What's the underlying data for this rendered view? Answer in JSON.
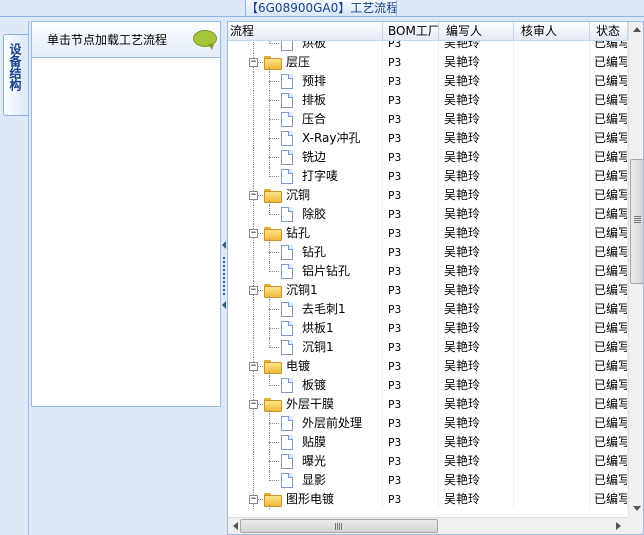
{
  "window": {
    "title": "【6G08900GA0】工艺流程"
  },
  "side_tab": {
    "label": "设备结构"
  },
  "left_panel": {
    "hint": "单击节点加载工艺流程",
    "hint_icon": "speech-bubble-icon"
  },
  "grid": {
    "columns": [
      "流程",
      "BOM工厂",
      "编写人",
      "核审人",
      "状态"
    ],
    "rows": [
      {
        "label": "烘板",
        "type": "leaf",
        "bom": "P3",
        "author": "吴艳玲",
        "reviewer": "",
        "status": "已编写"
      },
      {
        "label": "层压",
        "type": "folder",
        "bom": "P3",
        "author": "吴艳玲",
        "reviewer": "",
        "status": "已编写"
      },
      {
        "label": "预排",
        "type": "leaf",
        "bom": "P3",
        "author": "吴艳玲",
        "reviewer": "",
        "status": "已编写"
      },
      {
        "label": "排板",
        "type": "leaf",
        "bom": "P3",
        "author": "吴艳玲",
        "reviewer": "",
        "status": "已编写"
      },
      {
        "label": "压合",
        "type": "leaf",
        "bom": "P3",
        "author": "吴艳玲",
        "reviewer": "",
        "status": "已编写"
      },
      {
        "label": "X-Ray冲孔",
        "type": "leaf",
        "bom": "P3",
        "author": "吴艳玲",
        "reviewer": "",
        "status": "已编写"
      },
      {
        "label": "铣边",
        "type": "leaf",
        "bom": "P3",
        "author": "吴艳玲",
        "reviewer": "",
        "status": "已编写"
      },
      {
        "label": "打字唛",
        "type": "leaf",
        "bom": "P3",
        "author": "吴艳玲",
        "reviewer": "",
        "status": "已编写"
      },
      {
        "label": "沉铜",
        "type": "folder",
        "bom": "P3",
        "author": "吴艳玲",
        "reviewer": "",
        "status": "已编写"
      },
      {
        "label": "除胶",
        "type": "leaf",
        "bom": "P3",
        "author": "吴艳玲",
        "reviewer": "",
        "status": "已编写"
      },
      {
        "label": "钻孔",
        "type": "folder",
        "bom": "P3",
        "author": "吴艳玲",
        "reviewer": "",
        "status": "已编写"
      },
      {
        "label": "钻孔",
        "type": "leaf",
        "bom": "P3",
        "author": "吴艳玲",
        "reviewer": "",
        "status": "已编写"
      },
      {
        "label": "铝片钻孔",
        "type": "leaf",
        "bom": "P3",
        "author": "吴艳玲",
        "reviewer": "",
        "status": "已编写"
      },
      {
        "label": "沉铜1",
        "type": "folder",
        "bom": "P3",
        "author": "吴艳玲",
        "reviewer": "",
        "status": "已编写"
      },
      {
        "label": "去毛刺1",
        "type": "leaf",
        "bom": "P3",
        "author": "吴艳玲",
        "reviewer": "",
        "status": "已编写"
      },
      {
        "label": "烘板1",
        "type": "leaf",
        "bom": "P3",
        "author": "吴艳玲",
        "reviewer": "",
        "status": "已编写"
      },
      {
        "label": "沉铜1",
        "type": "leaf",
        "bom": "P3",
        "author": "吴艳玲",
        "reviewer": "",
        "status": "已编写"
      },
      {
        "label": "电镀",
        "type": "folder",
        "bom": "P3",
        "author": "吴艳玲",
        "reviewer": "",
        "status": "已编写"
      },
      {
        "label": "板镀",
        "type": "leaf",
        "bom": "P3",
        "author": "吴艳玲",
        "reviewer": "",
        "status": "已编写"
      },
      {
        "label": "外层干膜",
        "type": "folder",
        "bom": "P3",
        "author": "吴艳玲",
        "reviewer": "",
        "status": "已编写"
      },
      {
        "label": "外层前处理",
        "type": "leaf",
        "bom": "P3",
        "author": "吴艳玲",
        "reviewer": "",
        "status": "已编写"
      },
      {
        "label": "贴膜",
        "type": "leaf",
        "bom": "P3",
        "author": "吴艳玲",
        "reviewer": "",
        "status": "已编写"
      },
      {
        "label": "曝光",
        "type": "leaf",
        "bom": "P3",
        "author": "吴艳玲",
        "reviewer": "",
        "status": "已编写"
      },
      {
        "label": "显影",
        "type": "leaf",
        "bom": "P3",
        "author": "吴艳玲",
        "reviewer": "",
        "status": "已编写"
      },
      {
        "label": "图形电镀",
        "type": "folder",
        "bom": "P3",
        "author": "吴艳玲",
        "reviewer": "",
        "status": "已编写"
      }
    ]
  },
  "colors": {
    "panel_bg": "#dfe8f6",
    "border": "#99bbe8",
    "title_text": "#15428b",
    "folder": "#f0b93a"
  }
}
